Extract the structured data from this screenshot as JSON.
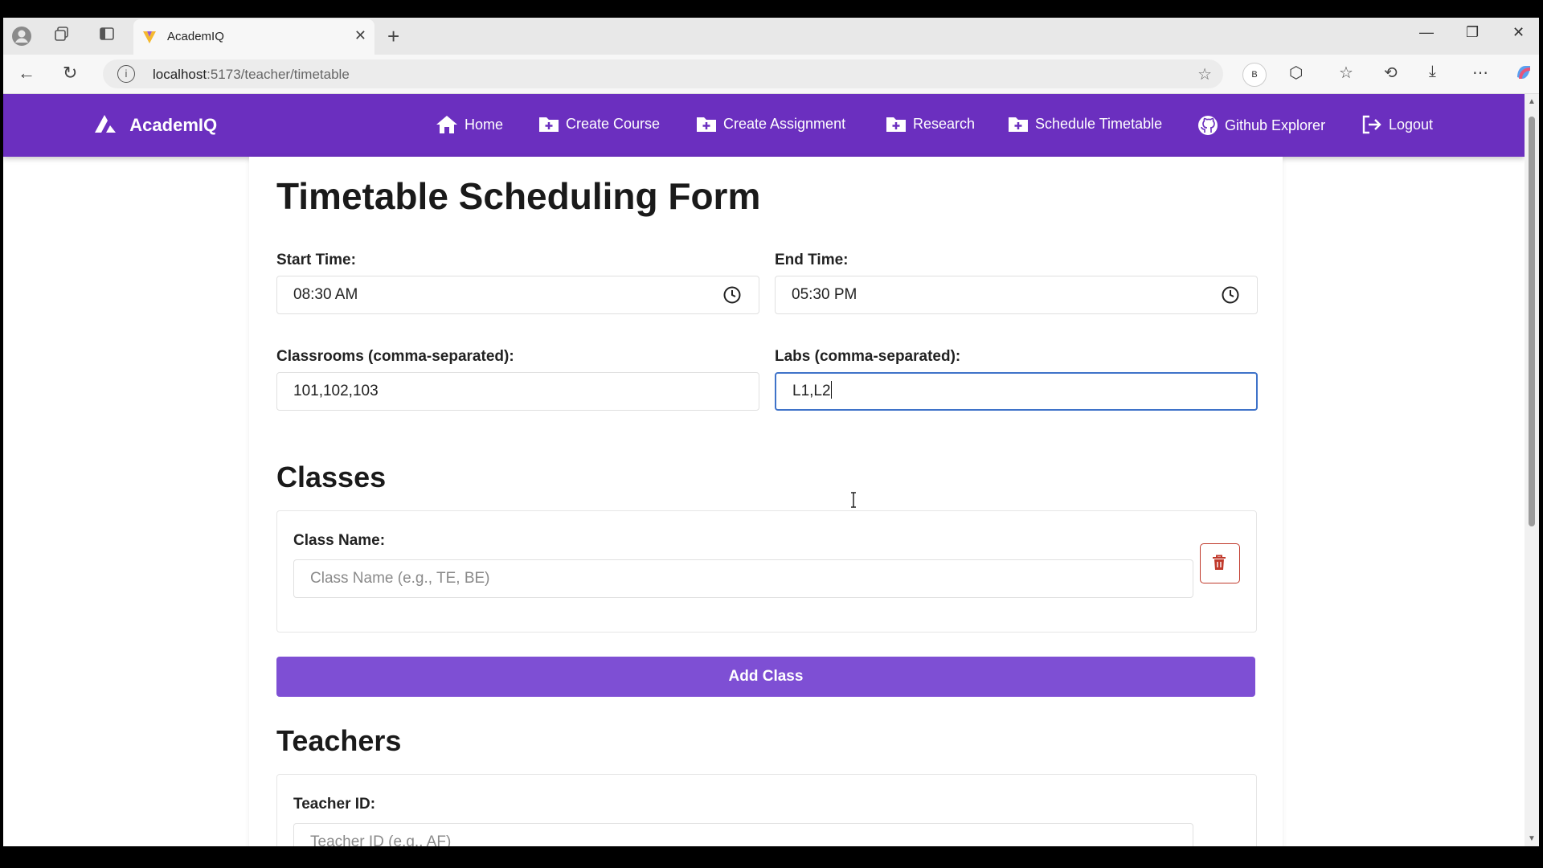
{
  "browser": {
    "tab_title": "AcademIQ",
    "url_host": "localhost",
    "url_path": ":5173/teacher/timetable",
    "profile_initial": "B"
  },
  "nav": {
    "brand": "AcademIQ",
    "items": [
      {
        "label": "Home",
        "icon": "home-icon"
      },
      {
        "label": "Create Course",
        "icon": "folder-plus-icon"
      },
      {
        "label": "Create Assignment",
        "icon": "folder-plus-icon"
      },
      {
        "label": "Research",
        "icon": "folder-plus-icon"
      },
      {
        "label": "Schedule Timetable",
        "icon": "folder-plus-icon"
      },
      {
        "label": "Github Explorer",
        "icon": "github-icon"
      },
      {
        "label": "Logout",
        "icon": "logout-icon"
      }
    ]
  },
  "form": {
    "title": "Timetable Scheduling Form",
    "start_time_label": "Start Time:",
    "start_time_value": "08:30 AM",
    "end_time_label": "End Time:",
    "end_time_value": "05:30 PM",
    "classrooms_label": "Classrooms (comma-separated):",
    "classrooms_value": "101,102,103",
    "labs_label": "Labs (comma-separated):",
    "labs_value": "L1,L2"
  },
  "classes": {
    "heading": "Classes",
    "class_name_label": "Class Name:",
    "class_name_placeholder": "Class Name (e.g., TE, BE)",
    "add_button": "Add Class"
  },
  "teachers": {
    "heading": "Teachers",
    "teacher_id_label": "Teacher ID:",
    "teacher_id_placeholder": "Teacher ID (e.g., AF)"
  },
  "colors": {
    "nav_bg": "#6b2fbf",
    "add_button_bg": "#7e4fd4",
    "delete_accent": "#c0392b",
    "focus_border": "#3f73c9"
  }
}
